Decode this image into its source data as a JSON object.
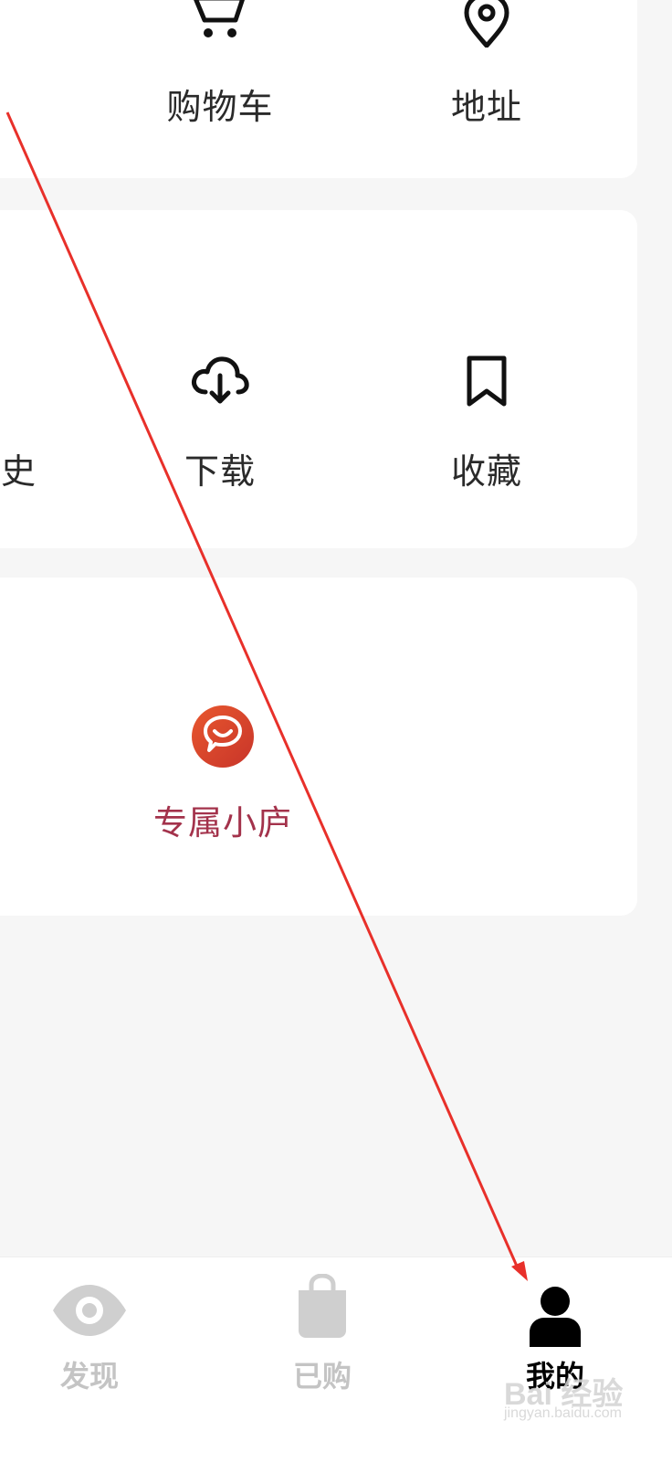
{
  "cards": {
    "card1": {
      "items": [
        {
          "label": "购物车",
          "icon": "shopping-cart-icon"
        },
        {
          "label": "地址",
          "icon": "location-pin-icon"
        }
      ]
    },
    "card2": {
      "items": [
        {
          "label": "史",
          "icon": "history-icon"
        },
        {
          "label": "下载",
          "icon": "cloud-download-icon"
        },
        {
          "label": "收藏",
          "icon": "bookmark-icon"
        }
      ]
    },
    "card3": {
      "items": [
        {
          "label": "专属小庐",
          "icon": "chat-smile-icon",
          "label_color": "#a3324b",
          "icon_color": "#d9482b"
        }
      ]
    }
  },
  "bottom_nav": {
    "items": [
      {
        "label": "发现",
        "icon": "eye-icon",
        "active": false
      },
      {
        "label": "已购",
        "icon": "shopping-bag-icon",
        "active": false
      },
      {
        "label": "我的",
        "icon": "user-icon",
        "active": true
      }
    ]
  },
  "watermark": {
    "text": "Bai 经验",
    "sub": "jingyan.baidu.com"
  },
  "annotation": {
    "color": "#e8302a"
  }
}
